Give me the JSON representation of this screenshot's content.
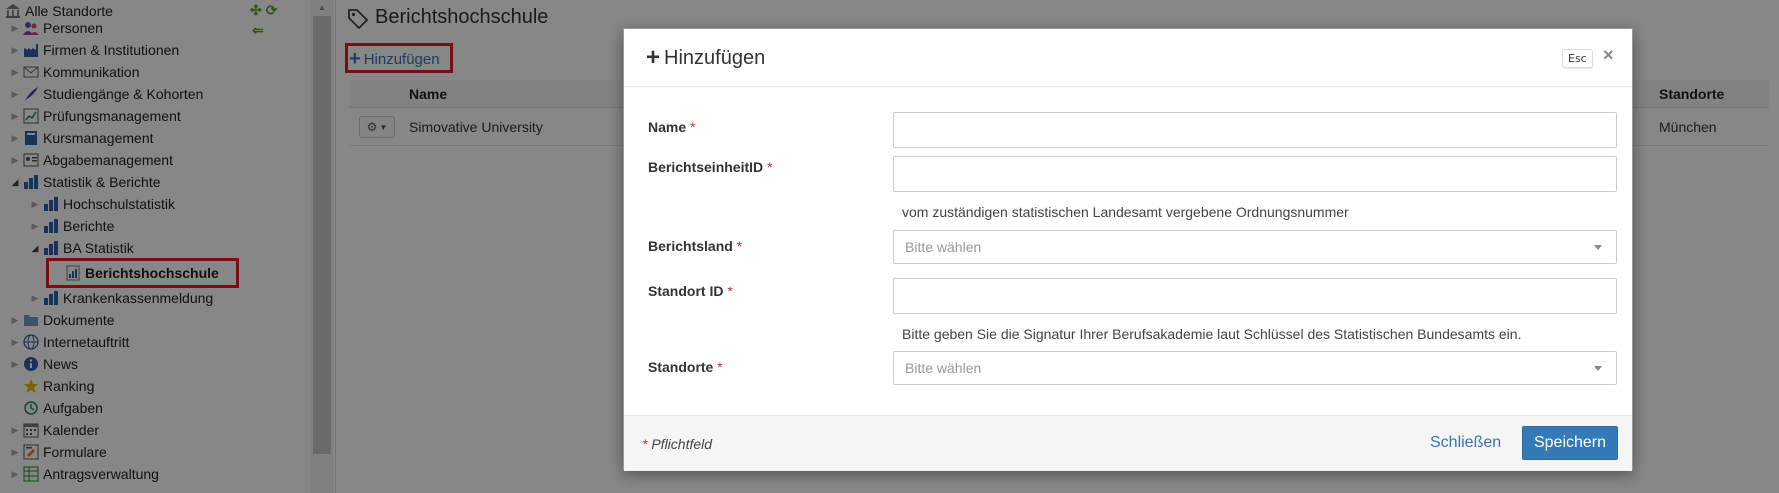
{
  "sidebar": {
    "root_label": "Alle Standorte",
    "items": [
      {
        "label": "Personen",
        "icon": "people-icon"
      },
      {
        "label": "Firmen & Institutionen",
        "icon": "factory-icon"
      },
      {
        "label": "Kommunikation",
        "icon": "envelope-icon"
      },
      {
        "label": "Studiengänge & Kohorten",
        "icon": "quill-icon"
      },
      {
        "label": "Prüfungsmanagement",
        "icon": "chart-board-icon"
      },
      {
        "label": "Kursmanagement",
        "icon": "book-icon"
      },
      {
        "label": "Abgabemanagement",
        "icon": "id-card-icon"
      },
      {
        "label": "Statistik & Berichte",
        "icon": "bar-chart-icon"
      },
      {
        "label": "Hochschulstatistik",
        "icon": "bar-chart-icon"
      },
      {
        "label": "Berichte",
        "icon": "bar-chart-icon"
      },
      {
        "label": "BA Statistik",
        "icon": "bar-chart-icon"
      },
      {
        "label": "Berichtshochschule",
        "icon": "report-icon"
      },
      {
        "label": "Krankenkassenmeldung",
        "icon": "bar-chart-icon"
      },
      {
        "label": "Dokumente",
        "icon": "folder-icon"
      },
      {
        "label": "Internetauftritt",
        "icon": "globe-icon"
      },
      {
        "label": "News",
        "icon": "info-icon"
      },
      {
        "label": "Ranking",
        "icon": "star-icon"
      },
      {
        "label": "Aufgaben",
        "icon": "history-icon"
      },
      {
        "label": "Kalender",
        "icon": "calendar-icon"
      },
      {
        "label": "Formulare",
        "icon": "form-icon"
      },
      {
        "label": "Antragsverwaltung",
        "icon": "table-icon"
      }
    ]
  },
  "main": {
    "title": "Berichtshochschule",
    "add_label": "Hinzufügen",
    "table": {
      "columns": [
        "Name",
        "Standorte"
      ],
      "rows": [
        {
          "name": "Simovative University",
          "standorte": "München"
        }
      ]
    }
  },
  "modal": {
    "title": "Hinzufügen",
    "esc_label": "Esc",
    "close_glyph": "×",
    "fields": {
      "name": {
        "label": "Name",
        "value": ""
      },
      "berichtseinheit": {
        "label": "BerichtseinheitID",
        "value": "",
        "help": "vom zuständigen statistischen Landesamt vergebene Ordnungsnummer"
      },
      "berichtsland": {
        "label": "Berichtsland",
        "placeholder": "Bitte wählen"
      },
      "standort_id": {
        "label": "Standort ID",
        "value": "",
        "help": "Bitte geben Sie die Signatur Ihrer Berufsakademie laut Schlüssel des Statistischen Bundesamts ein."
      },
      "standorte": {
        "label": "Standorte",
        "placeholder": "Bitte wählen"
      }
    },
    "required_marker": "*",
    "required_note": "Pflichtfeld",
    "close_button": "Schließen",
    "save_button": "Speichern"
  },
  "colors": {
    "accent": "#337ab7",
    "link": "#3875b5",
    "highlight": "#e01b24",
    "required": "#c9302c"
  }
}
